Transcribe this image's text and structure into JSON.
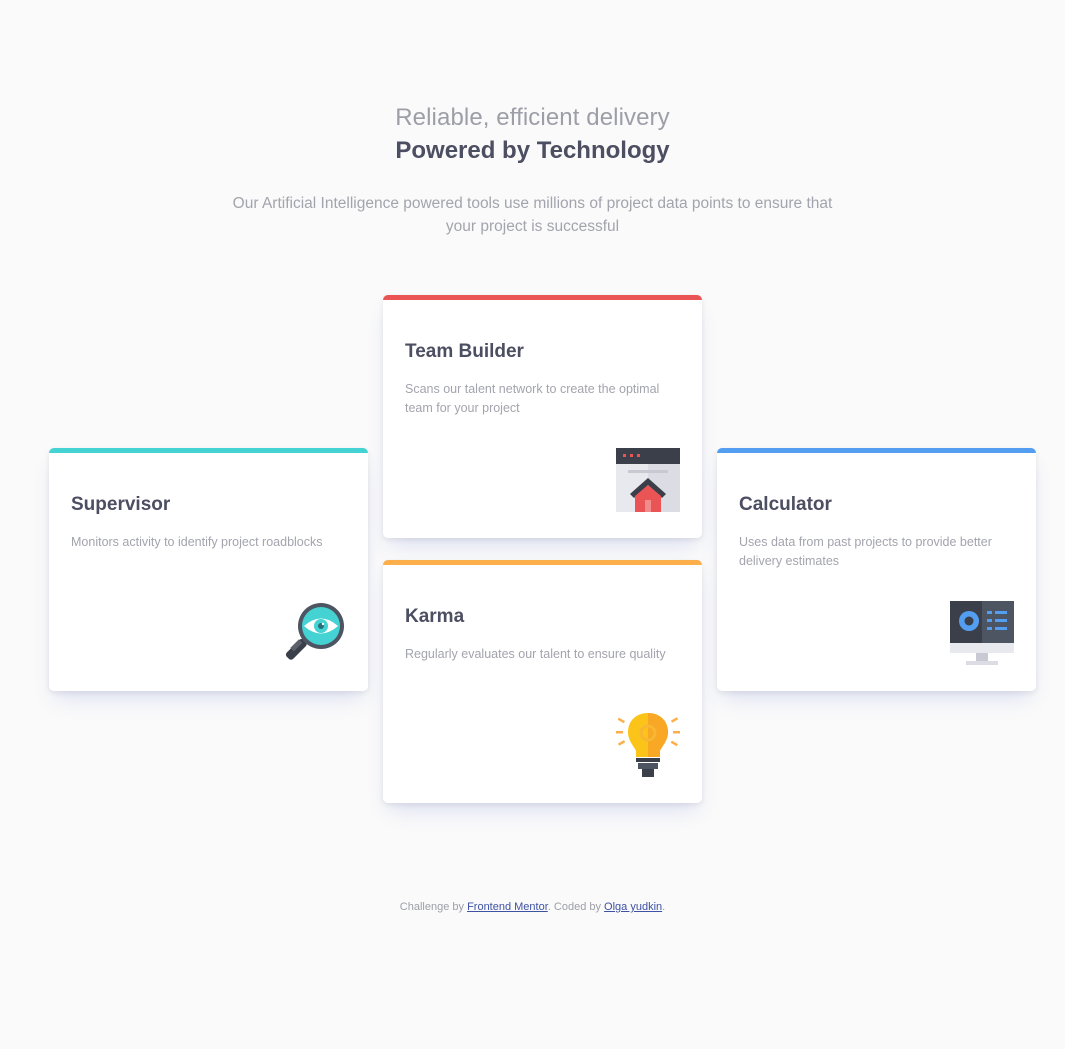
{
  "header": {
    "subtitle": "Reliable, efficient delivery",
    "title": "Powered by Technology",
    "intro": "Our Artificial Intelligence powered tools use millions of project data points to ensure that your project is successful"
  },
  "cards": {
    "supervisor": {
      "title": "Supervisor",
      "description": "Monitors activity to identify project roadblocks",
      "accent": "#44d3d2",
      "icon": "magnifier-eye-icon"
    },
    "team_builder": {
      "title": "Team Builder",
      "description": "Scans our talent network to create the optimal team for your project",
      "accent": "#ea5454",
      "icon": "browser-house-icon"
    },
    "karma": {
      "title": "Karma",
      "description": "Regularly evaluates our talent to ensure quality",
      "accent": "#fcaf4a",
      "icon": "lightbulb-icon"
    },
    "calculator": {
      "title": "Calculator",
      "description": "Uses data from past projects to provide better delivery estimates",
      "accent": "#549ef2",
      "icon": "monitor-chart-icon"
    }
  },
  "footer": {
    "prefix": "Challenge by ",
    "link1": "Frontend Mentor",
    "middle": ". Coded by ",
    "link2": "Olga yudkin",
    "suffix": "."
  }
}
